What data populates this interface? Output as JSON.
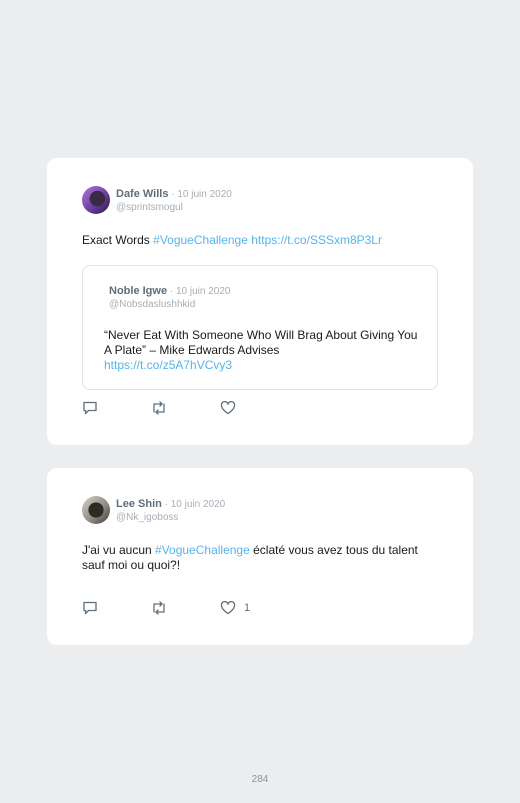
{
  "tweets": [
    {
      "author": "Dafe Wills",
      "separator": " · ",
      "date": "10 juin 2020",
      "handle": "@sprintsmogul",
      "text_plain": "Exact Words ",
      "hashtag": "#VogueChallenge",
      "link": "https://t.co/SSSxm8P3Lr",
      "quote": {
        "author": "Noble Igwe",
        "separator": " · ",
        "date": "10 juin 2020",
        "handle": "@Nobsdaslushhkid",
        "text": "“Never Eat With Someone Who Will Brag About Giving You A Plate” – Mike Edwards Advises",
        "link": "https://t.co/z5A7hVCvy3"
      },
      "likes": ""
    },
    {
      "author": "Lee Shin",
      "separator": " · ",
      "date": "10 juin 2020",
      "handle": "@Nk_igoboss",
      "text_before": "J'ai vu aucun ",
      "hashtag": "#VogueChallenge",
      "text_after": " éclaté vous avez tous du talent sauf moi ou quoi?!",
      "likes": "1"
    }
  ],
  "icons": {
    "reply": "reply-icon",
    "retweet": "retweet-icon",
    "like": "heart-icon"
  },
  "colors": {
    "background": "#ebedef",
    "card": "#ffffff",
    "link": "#56b4e9",
    "muted": "#a7aeb5"
  },
  "page_number": "284"
}
